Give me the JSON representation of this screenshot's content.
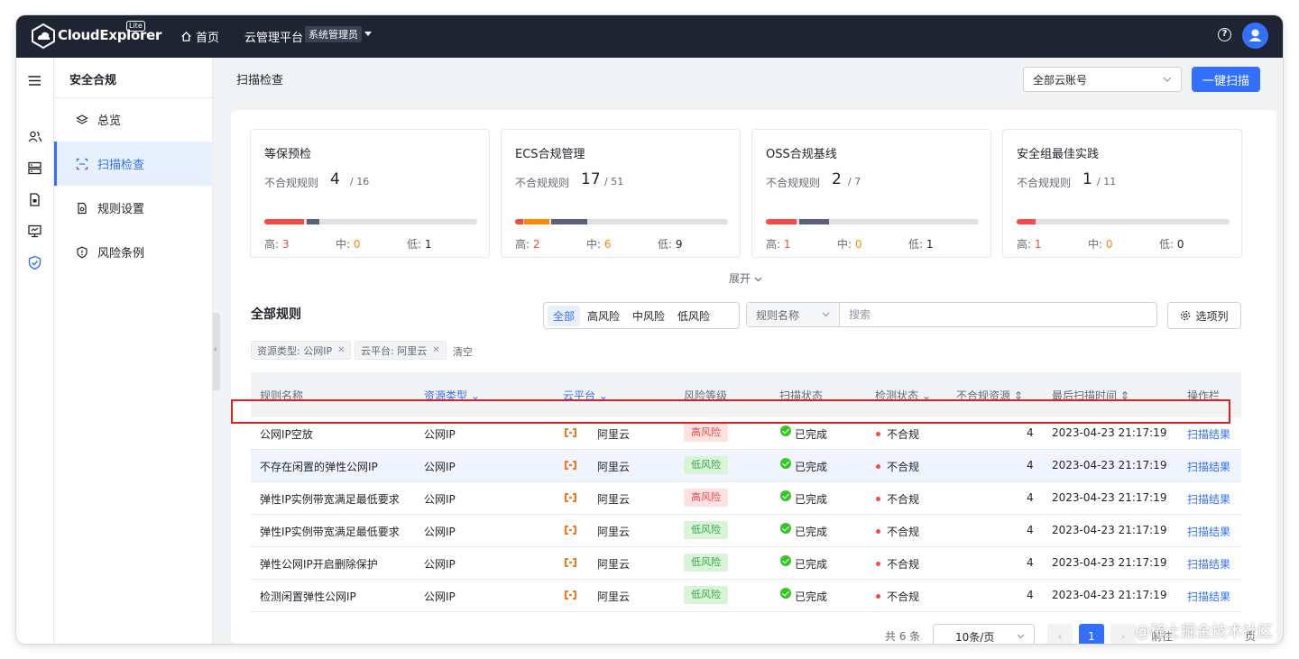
{
  "header": {
    "brand": "CloudExplorer",
    "brand_badge": "Lite",
    "nav_home": "首页",
    "nav_cloud": "云管理平台",
    "role": "系统管理员",
    "help": "?"
  },
  "rail_icons": [
    "menu-icon",
    "users-icon",
    "server-icon",
    "report-icon",
    "monitor-icon",
    "shield-icon"
  ],
  "sidebar": {
    "title": "安全合规",
    "items": [
      {
        "label": "总览",
        "icon": "layers-icon"
      },
      {
        "label": "扫描检查",
        "icon": "scan-icon",
        "active": true
      },
      {
        "label": "规则设置",
        "icon": "doc-settings-icon"
      },
      {
        "label": "风险条例",
        "icon": "shield-alert-icon"
      }
    ]
  },
  "toolbar": {
    "page_title": "扫描检查",
    "account_select": "全部云账号",
    "scan_button": "一键扫描"
  },
  "stats": [
    {
      "title": "等保预检",
      "label": "不合规规则",
      "value": "4",
      "total": "/ 16",
      "high_label": "高:",
      "high": "3",
      "mid_label": "中:",
      "mid": "0",
      "low_label": "低:",
      "low": "1"
    },
    {
      "title": "ECS合规管理",
      "label": "不合规规则",
      "value": "17",
      "total": "/ 51",
      "high_label": "高:",
      "high": "2",
      "mid_label": "中:",
      "mid": "6",
      "low_label": "低:",
      "low": "9"
    },
    {
      "title": "OSS合规基线",
      "label": "不合规规则",
      "value": "2",
      "total": "/ 7",
      "high_label": "高:",
      "high": "1",
      "mid_label": "中:",
      "mid": "0",
      "low_label": "低:",
      "low": "1"
    },
    {
      "title": "安全组最佳实践",
      "label": "不合规规则",
      "value": "1",
      "total": "/ 11",
      "high_label": "高:",
      "high": "1",
      "mid_label": "中:",
      "mid": "0",
      "low_label": "低:",
      "low": "0"
    }
  ],
  "expand_label": "展开",
  "rules": {
    "title": "全部规则",
    "risk_filters": [
      "全部",
      "高风险",
      "中风险",
      "低风险"
    ],
    "search_field": "规则名称",
    "search_placeholder": "搜索",
    "columns_button": "选项列",
    "filter_tags": [
      "资源类型: 公网IP",
      "云平台: 阿里云"
    ],
    "clear": "清空"
  },
  "table": {
    "headers": [
      "规则名称",
      "资源类型",
      "云平台",
      "风险等级",
      "扫描状态",
      "检测状态",
      "不合规资源",
      "最后扫描时间",
      "操作栏"
    ],
    "rows": [
      {
        "name": "公网IP空放",
        "type": "公网IP",
        "platform": "阿里云",
        "risk": "高风险",
        "risk_level": "high",
        "scan": "已完成",
        "check": "不合规",
        "count": "4",
        "time": "2023-04-23 21:17:19",
        "action": "扫描结果"
      },
      {
        "name": "不存在闲置的弹性公网IP",
        "type": "公网IP",
        "platform": "阿里云",
        "risk": "低风险",
        "risk_level": "low",
        "scan": "已完成",
        "check": "不合规",
        "count": "4",
        "time": "2023-04-23 21:17:19",
        "action": "扫描结果"
      },
      {
        "name": "弹性IP实例带宽满足最低要求",
        "type": "公网IP",
        "platform": "阿里云",
        "risk": "高风险",
        "risk_level": "high",
        "scan": "已完成",
        "check": "不合规",
        "count": "4",
        "time": "2023-04-23 21:17:19",
        "action": "扫描结果"
      },
      {
        "name": "弹性IP实例带宽满足最低要求",
        "type": "公网IP",
        "platform": "阿里云",
        "risk": "低风险",
        "risk_level": "low",
        "scan": "已完成",
        "check": "不合规",
        "count": "4",
        "time": "2023-04-23 21:17:19",
        "action": "扫描结果"
      },
      {
        "name": "弹性公网IP开启删除保护",
        "type": "公网IP",
        "platform": "阿里云",
        "risk": "低风险",
        "risk_level": "low",
        "scan": "已完成",
        "check": "不合规",
        "count": "4",
        "time": "2023-04-23 21:17:19",
        "action": "扫描结果"
      },
      {
        "name": "检测闲置弹性公网IP",
        "type": "公网IP",
        "platform": "阿里云",
        "risk": "低风险",
        "risk_level": "low",
        "scan": "已完成",
        "check": "不合规",
        "count": "4",
        "time": "2023-04-23 21:17:19",
        "action": "扫描结果"
      }
    ]
  },
  "pagination": {
    "total": "共 6 条",
    "page_size": "10条/页",
    "current": "1",
    "goto": "前往",
    "page_suffix": "页"
  },
  "watermark": "@稀土掘金技术社区",
  "colors": {
    "accent": "#3370ff",
    "header_bg": "#1e2432",
    "danger": "#f54a45",
    "warning": "#ff8800",
    "success": "#34c724"
  }
}
